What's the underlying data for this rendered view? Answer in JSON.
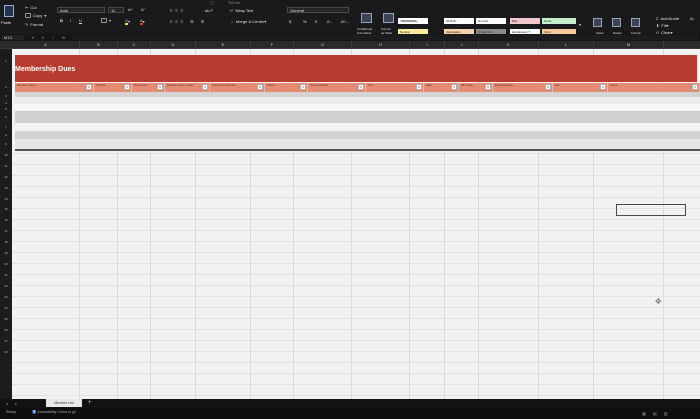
{
  "ribbon": {
    "menu_text": "Tell me",
    "clipboard": {
      "paste": "Paste",
      "cut": "Cut",
      "copy": "Copy",
      "format": "Format"
    },
    "font": {
      "name": "Arial",
      "size": "11",
      "bold": "B",
      "italic": "I",
      "underline": "U"
    },
    "alignment": {
      "wrap_text": "Wrap Text",
      "merge_center": "Merge & Center"
    },
    "number": {
      "format": "General",
      "currency": "$",
      "percent": "%"
    },
    "styles": {
      "conditional": "Conditional\nFormatting",
      "format_table": "Format\nas Table",
      "cells": [
        {
          "label": "\\r$$$$$$$$$...",
          "color": "#ffffff"
        },
        {
          "label": "\\Tiplicki...",
          "color": "#ffffff"
        },
        {
          "label": "Normal",
          "color": "#ffffff"
        },
        {
          "label": "Bad",
          "color": "#f3c7cc"
        },
        {
          "label": "Good",
          "color": "#c6efce"
        },
        {
          "label": "Neutral",
          "color": "#ffeb9c"
        },
        {
          "label": "Calculation",
          "color": "#f2d2a8"
        },
        {
          "label": "Check Cell",
          "color": "#8c8c8c"
        },
        {
          "label": "Explanatory T...",
          "color": "#ffffff"
        },
        {
          "label": "Input",
          "color": "#f6c99a"
        }
      ]
    },
    "cells_group": {
      "insert": "Insert",
      "delete": "Delete",
      "format": "Format"
    },
    "editing": {
      "autosum": "AutoSum",
      "fill": "Fill",
      "clear": "Clear"
    }
  },
  "formula_bar": {
    "name_box": "M13",
    "fx": "fx",
    "value": ""
  },
  "columns": [
    "A",
    "B",
    "C",
    "D",
    "E",
    "F",
    "G",
    "H",
    "I",
    "J",
    "K",
    "L",
    "M"
  ],
  "rows": [
    "1",
    "2",
    "3",
    "4",
    "5",
    "6",
    "7",
    "8",
    "9",
    "10",
    "11",
    "12",
    "13",
    "14",
    "15",
    "16",
    "17",
    "18",
    "19",
    "20",
    "21",
    "22",
    "23",
    "24",
    "25",
    "26",
    "27",
    "28"
  ],
  "sheet": {
    "title": "Membership Dues",
    "headers": [
      "Member Name",
      "Thanks",
      "Dues Paid",
      "Member Since (Year)",
      "Volunteer Interests",
      "Phone",
      "Street Address",
      "City",
      "State",
      "ZIP Code",
      "Email Address",
      "Fax",
      "Notes"
    ],
    "filter_glyph": "▾",
    "colors": {
      "title_fill": "#b73b2e",
      "header_fill": "#e48b74"
    }
  },
  "tabs": {
    "sheet_name": "Member List",
    "add": "+"
  },
  "status": {
    "ready": "Ready",
    "accessibility": "Accessibility: Good to go"
  }
}
